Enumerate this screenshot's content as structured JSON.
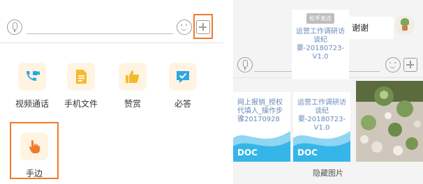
{
  "left_panel": {
    "apps": [
      {
        "label": "视频通话",
        "icon": "video-call-icon"
      },
      {
        "label": "手机文件",
        "icon": "phone-file-icon"
      },
      {
        "label": "赞赏",
        "icon": "thumbs-up-icon"
      },
      {
        "label": "必答",
        "icon": "check-message-icon"
      },
      {
        "label": "手边",
        "icon": "hand-pointer-icon"
      }
    ],
    "highlight_color": "#f07a2a"
  },
  "right_panel": {
    "bubble_text": "了，谢谢",
    "overlay": {
      "tag": "松手发送",
      "doc_name": "运营工作调研访谈纪要-20180723-V1.0"
    },
    "cards": [
      {
        "doc_name": "网上报销_授权代填人_操作步骤20170928",
        "type": "DOC"
      },
      {
        "doc_name": "运营工作调研访谈纪要-20180723-V1.0",
        "type": "DOC"
      }
    ],
    "caption": "隐藏图片"
  },
  "colors": {
    "accent": "#f07a2a",
    "app_tile_bg": "#fff4e2",
    "icon_blue": "#2ea7e0",
    "icon_yellow": "#f7b92c",
    "doc_wave": "#35b5e8",
    "doc_name_text": "#6a8ab8"
  }
}
